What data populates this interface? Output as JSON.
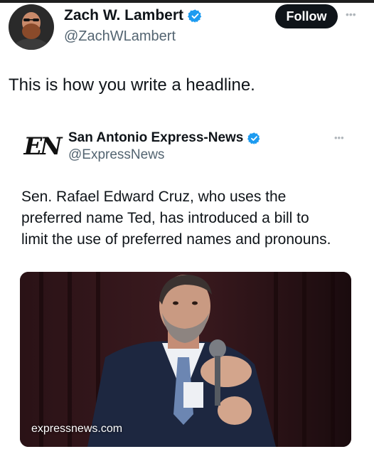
{
  "tweet": {
    "author": {
      "name": "Zach W. Lambert",
      "handle": "@ZachWLambert"
    },
    "follow_label": "Follow",
    "more_label": "•••",
    "text": "This is how you write a headline."
  },
  "quoted_tweet": {
    "logo_text": "EN",
    "author": {
      "name": "San Antonio Express-News",
      "handle": "@ExpressNews"
    },
    "more_label": "•••",
    "text_lines": [
      "Sen. Rafael Edward Cruz, who uses the",
      "preferred name Ted, has introduced a bill to",
      "limit the use of preferred names and pronouns."
    ],
    "media": {
      "domain": "expressnews.com"
    }
  },
  "colors": {
    "verified": "#1d9bf0",
    "follow_bg": "#0f1419",
    "handle": "#536471"
  },
  "icons": {
    "verified": "verified-badge-icon",
    "more": "more-options-icon"
  }
}
